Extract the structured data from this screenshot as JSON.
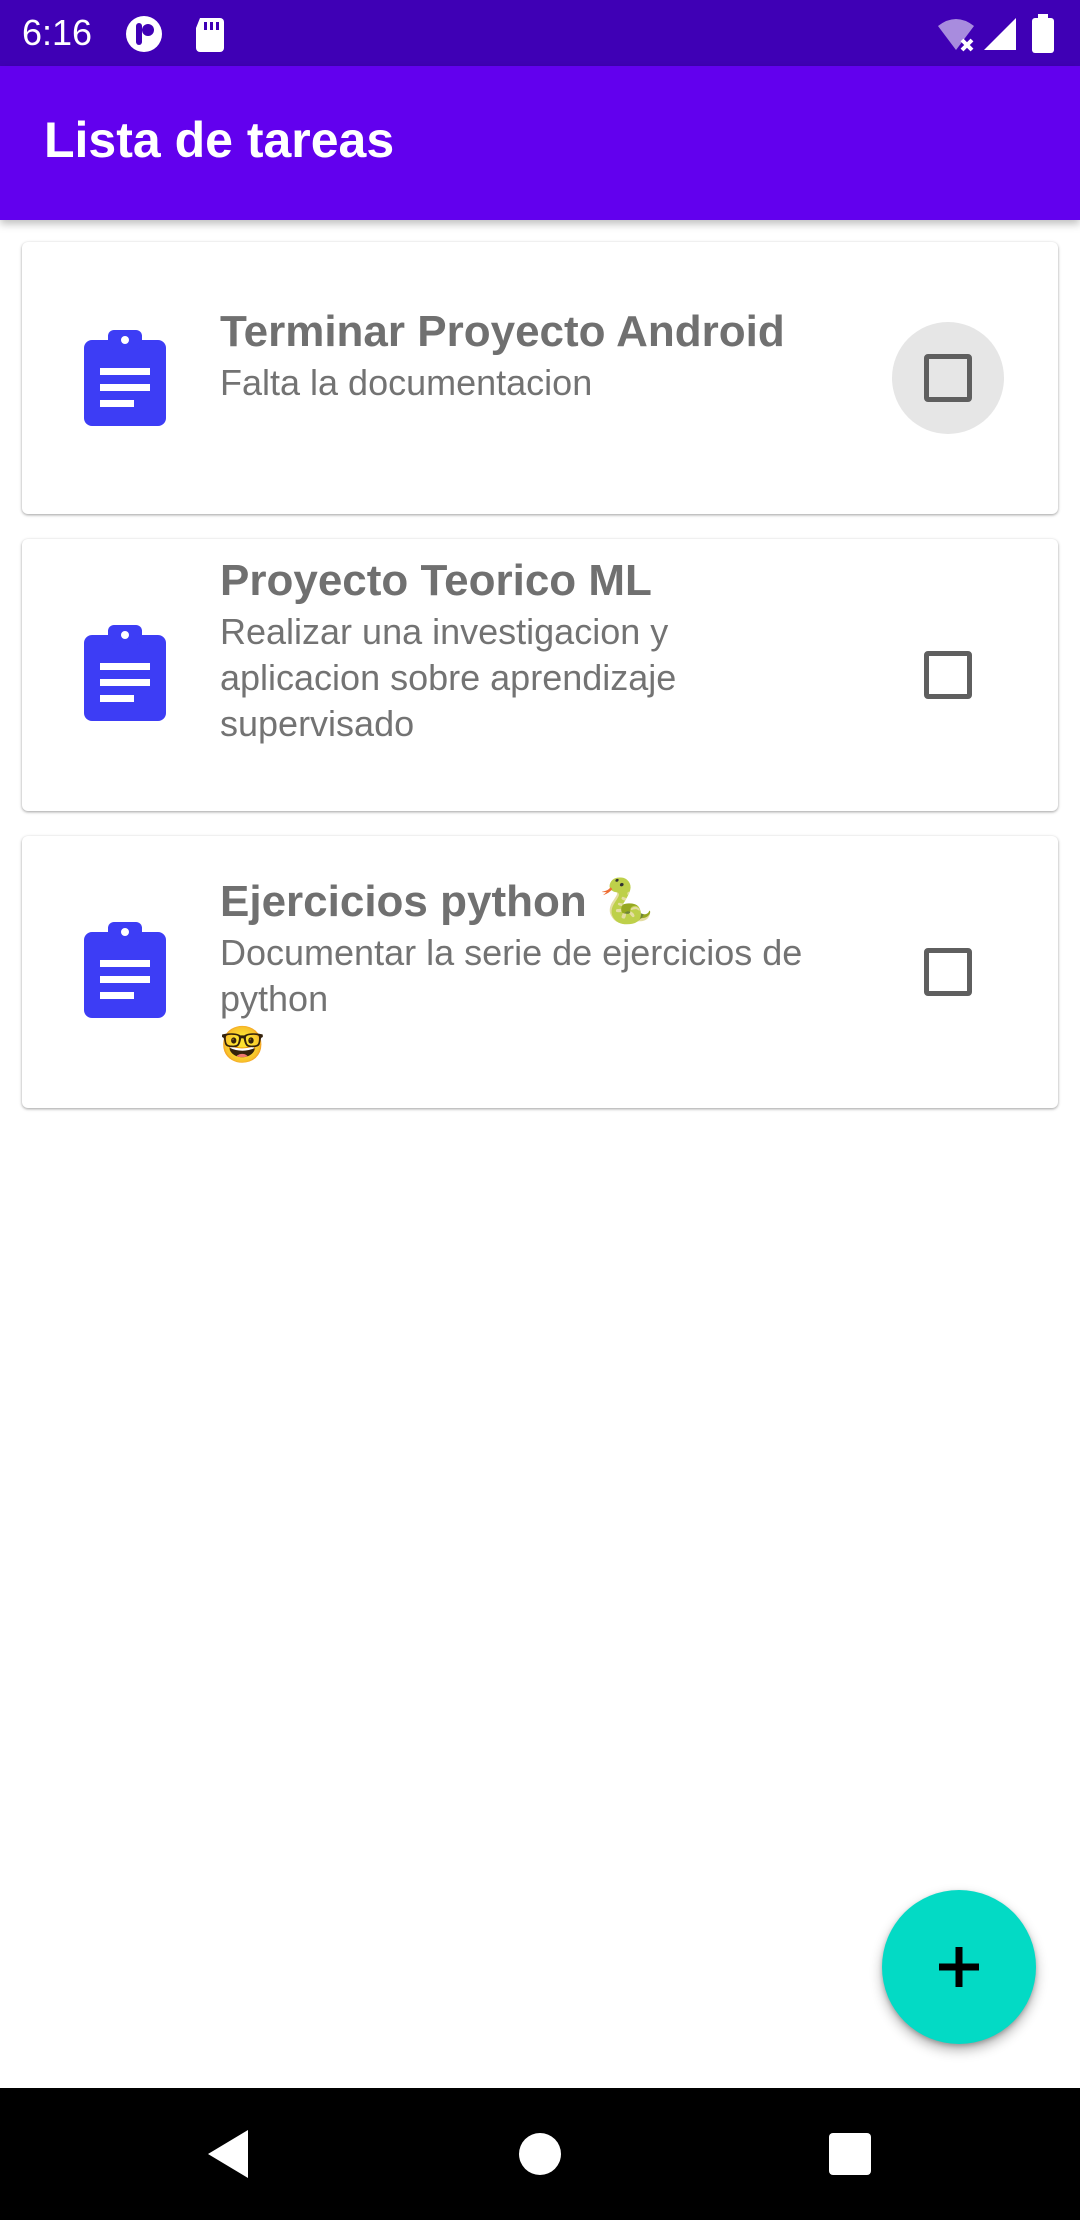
{
  "status_bar": {
    "time": "6:16",
    "icons": [
      "app-notification-icon",
      "sd-card-icon",
      "wifi-off-icon",
      "cell-signal-icon",
      "battery-icon"
    ]
  },
  "app_bar": {
    "title": "Lista de tareas"
  },
  "tasks": [
    {
      "title": "Terminar Proyecto Android",
      "description": "Falta la documentacion",
      "checked": false
    },
    {
      "title": "Proyecto Teorico ML",
      "description": "Realizar una investigacion y\naplicacion sobre aprendizaje\nsupervisado",
      "checked": false
    },
    {
      "title": "Ejercicios python 🐍",
      "description": "Documentar la serie de ejercicios de\npython\n🤓",
      "checked": false
    }
  ],
  "fab": {
    "icon": "plus-icon"
  },
  "nav_bar": {
    "icons": [
      "back-icon",
      "home-icon",
      "recents-icon"
    ]
  },
  "colors": {
    "status_bar": "#3f00b5",
    "app_bar": "#6200ee",
    "task_icon": "#3d3df5",
    "fab": "#03dac5"
  }
}
